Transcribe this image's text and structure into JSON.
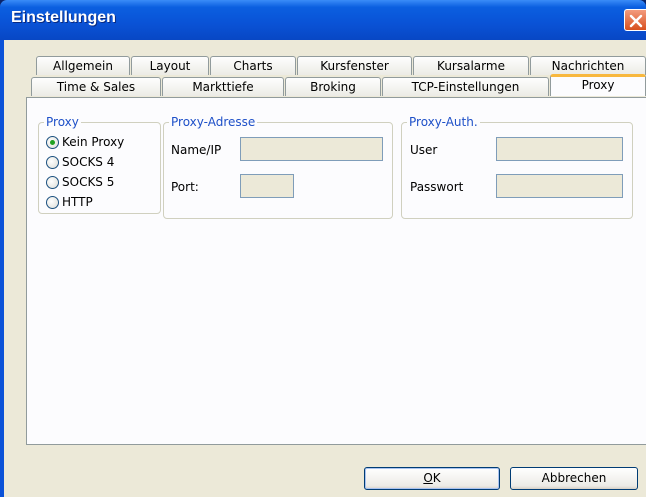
{
  "window": {
    "title": "Einstellungen",
    "close_icon": "close-icon"
  },
  "tabs": {
    "row_back": [
      "Allgemein",
      "Layout",
      "Charts",
      "Kursfenster",
      "Kursalarme",
      "Nachrichten"
    ],
    "row_front": [
      "Time & Sales",
      "Markttiefe",
      "Broking",
      "TCP-Einstellungen",
      "Proxy"
    ],
    "active": "Proxy"
  },
  "proxy_group": {
    "label": "Proxy",
    "options": [
      "Kein Proxy",
      "SOCKS 4",
      "SOCKS 5",
      "HTTP"
    ],
    "selected": "Kein Proxy"
  },
  "proxy_address": {
    "label": "Proxy-Adresse",
    "name_label": "Name/IP",
    "name_value": "",
    "port_label": "Port:",
    "port_value": ""
  },
  "proxy_auth": {
    "label": "Proxy-Auth.",
    "user_label": "User",
    "user_value": "",
    "password_label": "Passwort",
    "password_value": ""
  },
  "buttons": {
    "ok_mnemonic": "O",
    "ok_rest": "K",
    "cancel": "Abbrechen"
  },
  "colors": {
    "titlebar": "#0a52d6",
    "dialog_bg": "#ece9d8",
    "group_label": "#1e50c8",
    "active_tab_accent": "#f8b83e",
    "radio_check": "#21a121"
  }
}
